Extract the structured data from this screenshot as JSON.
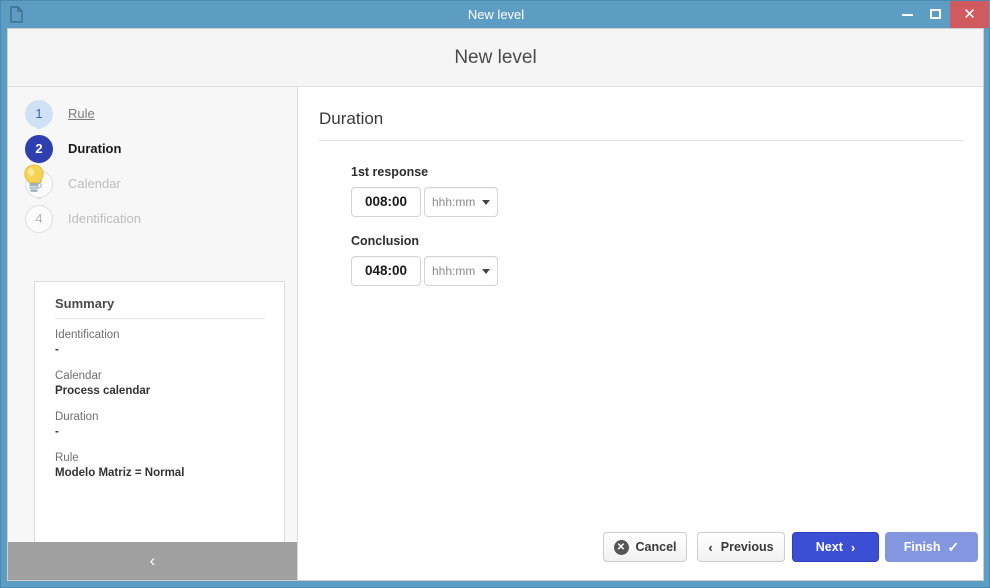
{
  "window": {
    "title": "New level",
    "icon": "document-icon",
    "controls": {
      "minimize": "–",
      "maximize": "□",
      "close": "✕"
    },
    "frame_color": "#5d9cc3",
    "close_color": "#d15a5e"
  },
  "dialog": {
    "header_title": "New level"
  },
  "wizard": {
    "steps": [
      {
        "number": "1",
        "label": "Rule",
        "state": "done"
      },
      {
        "number": "2",
        "label": "Duration",
        "state": "active"
      },
      {
        "number": "3",
        "label": "Calendar",
        "state": "todo"
      },
      {
        "number": "4",
        "label": "Identification",
        "state": "todo"
      }
    ],
    "active_color": "#2f3fb0",
    "done_color": "#cfe1f5"
  },
  "summary": {
    "title": "Summary",
    "icon": "lightbulb-icon",
    "items": [
      {
        "label": "Identification",
        "value": "-"
      },
      {
        "label": "Calendar",
        "value": "Process calendar"
      },
      {
        "label": "Duration",
        "value": "-"
      },
      {
        "label": "Rule",
        "value": "Modelo Matriz = Normal"
      }
    ]
  },
  "sidebar": {
    "collapse_icon": "‹"
  },
  "main": {
    "title": "Duration",
    "fields": [
      {
        "label": "1st response",
        "value": "008:00",
        "unit": "hhh:mm",
        "unit_icon": "chevron-down-icon"
      },
      {
        "label": "Conclusion",
        "value": "048:00",
        "unit": "hhh:mm",
        "unit_icon": "chevron-down-icon"
      }
    ]
  },
  "footer": {
    "cancel": {
      "label": "Cancel",
      "icon": "close-circle-icon"
    },
    "previous": {
      "label": "Previous",
      "icon": "chevron-left-icon",
      "glyph": "‹"
    },
    "next": {
      "label": "Next",
      "icon": "chevron-right-icon",
      "glyph": "›",
      "color": "#3b4fd4"
    },
    "finish": {
      "label": "Finish",
      "icon": "check-icon",
      "glyph": "✓",
      "color": "#8496e0"
    }
  }
}
